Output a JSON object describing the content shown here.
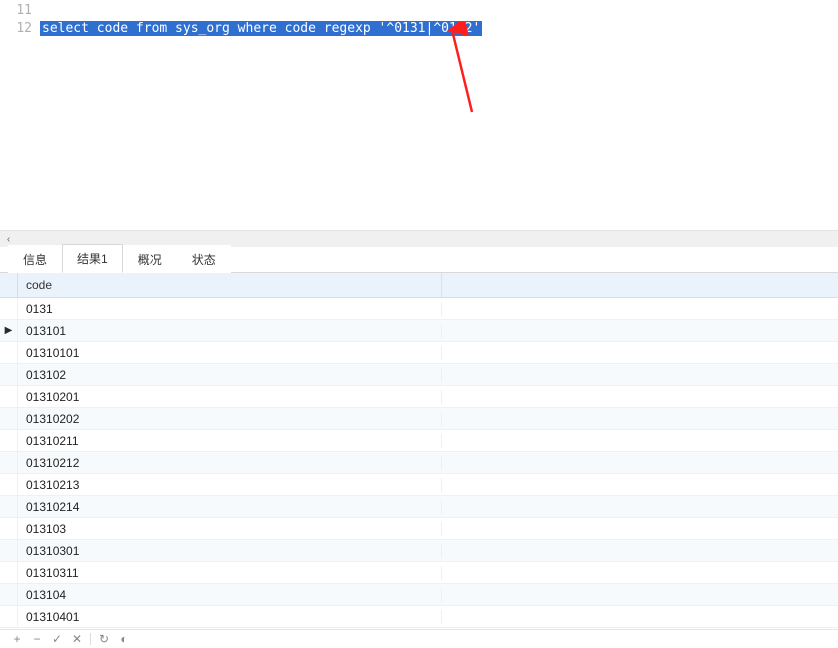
{
  "editor": {
    "lines": [
      {
        "num": "11",
        "text": ""
      },
      {
        "num": "12",
        "text": "select code from sys_org where code regexp '^0131|^0132'",
        "selected": true
      }
    ]
  },
  "tabs": {
    "info": "信息",
    "result1": "结果1",
    "overview": "概况",
    "status": "状态",
    "active": "result1"
  },
  "grid": {
    "header": {
      "code": "code"
    },
    "rows": [
      {
        "code": "0131"
      },
      {
        "code": "013101",
        "current": true
      },
      {
        "code": "01310101"
      },
      {
        "code": "013102"
      },
      {
        "code": "01310201"
      },
      {
        "code": "01310202"
      },
      {
        "code": "01310211"
      },
      {
        "code": "01310212"
      },
      {
        "code": "01310213"
      },
      {
        "code": "01310214"
      },
      {
        "code": "013103"
      },
      {
        "code": "01310301"
      },
      {
        "code": "01310311"
      },
      {
        "code": "013104"
      },
      {
        "code": "01310401"
      }
    ]
  },
  "icons": {
    "scroll_left": "‹",
    "row_marker": "▶"
  }
}
